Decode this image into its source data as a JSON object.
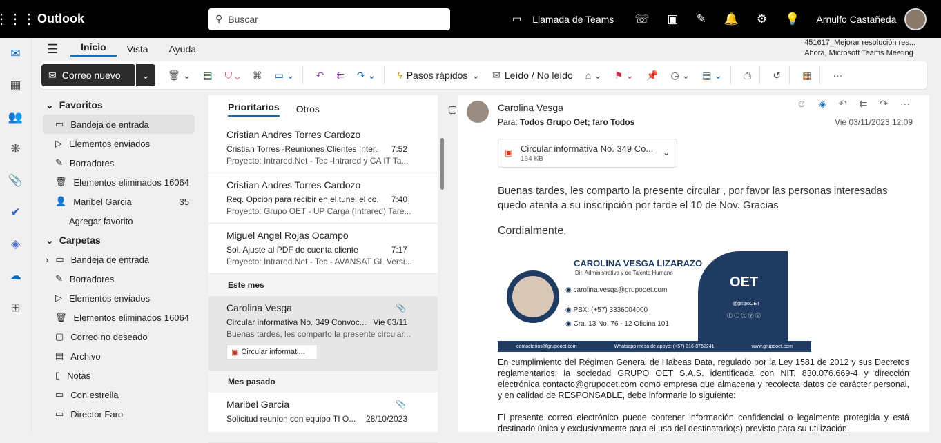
{
  "topbar": {
    "app_name": "Outlook",
    "search_placeholder": "Buscar",
    "teams_call": "Llamada de Teams",
    "user_name": "Arnulfo Castañeda"
  },
  "menubar": {
    "tabs": [
      "Inicio",
      "Vista",
      "Ayuda"
    ],
    "meeting_title": "451617_Mejorar resolución res...",
    "meeting_time": "Ahora, Microsoft Teams Meeting"
  },
  "ribbon": {
    "new_mail": "Correo nuevo",
    "quick_steps": "Pasos rápidos",
    "read_unread": "Leído / No leído"
  },
  "folders": {
    "favorites_header": "Favoritos",
    "favorites": [
      {
        "label": "Bandeja de entrada",
        "count": ""
      },
      {
        "label": "Elementos enviados",
        "count": ""
      },
      {
        "label": "Borradores",
        "count": ""
      },
      {
        "label": "Elementos eliminados",
        "count": "16064"
      },
      {
        "label": "Maribel Garcia",
        "count": "35"
      },
      {
        "label": "Agregar favorito",
        "count": ""
      }
    ],
    "folders_header": "Carpetas",
    "folders": [
      {
        "label": "Bandeja de entrada",
        "count": ""
      },
      {
        "label": "Borradores",
        "count": ""
      },
      {
        "label": "Elementos enviados",
        "count": ""
      },
      {
        "label": "Elementos eliminados",
        "count": "16064"
      },
      {
        "label": "Correo no deseado",
        "count": ""
      },
      {
        "label": "Archivo",
        "count": ""
      },
      {
        "label": "Notas",
        "count": ""
      },
      {
        "label": "Con estrella",
        "count": ""
      },
      {
        "label": "Director Faro",
        "count": ""
      }
    ]
  },
  "list": {
    "tab_focused": "Prioritarios",
    "tab_other": "Otros",
    "items": [
      {
        "from": "Cristian Andres Torres Cardozo",
        "subject": "Cristian Torres -Reuniones Clientes Inter...",
        "time": "7:52",
        "preview": "Proyecto: Intrared.Net - Tec -Intrared y CA IT Ta..."
      },
      {
        "from": "Cristian Andres Torres Cardozo",
        "subject": "Req. Opcion para recibir en el tunel el co...",
        "time": "7:40",
        "preview": "Proyecto: Grupo OET - UP Carga (Intrared) Tare..."
      },
      {
        "from": "Miguel Angel Rojas Ocampo",
        "subject": "Sol. Ajuste al PDF de cuenta cliente",
        "time": "7:17",
        "preview": "Proyecto: Intrared.Net - Tec - AVANSAT GL Versi..."
      }
    ],
    "group_this_month": "Este mes",
    "selected": {
      "from": "Carolina Vesga",
      "subject": "Circular informativa No. 349 Convoc...",
      "time": "Vie 03/11",
      "preview": "Buenas tardes, les comparto la presente circular...",
      "attachment": "Circular informati..."
    },
    "group_last_month": "Mes pasado",
    "last": {
      "from": "Maribel Garcia",
      "subject": "Solicitud reunion con equipo TI O...",
      "time": "28/10/2023"
    }
  },
  "reader": {
    "from": "Carolina Vesga",
    "to_label": "Para:",
    "to": "Todos Grupo Oet;   faro Todos",
    "date": "Vie 03/11/2023 12:09",
    "attachment_name": "Circular informativa No. 349 Co...",
    "attachment_size": "164 KB",
    "body_line": "Buenas tardes, les comparto la presente circular , por favor las personas interesadas quedo atenta a su inscripción por tarde el 10 de Nov. Gracias",
    "closing": "Cordialmente,",
    "signature": {
      "name": "CAROLINA VESGA LIZARAZO",
      "role": "Dir. Administrativa y de Talento Humano",
      "email": "carolina.vesga@grupooet.com",
      "phone": "PBX: (+57) 3336004000",
      "address": "Cra. 13 No. 76 - 12 Oficina 101",
      "brand": "OET",
      "handle": "@grupoOET",
      "footer_email": "contactenos@grupooet.com",
      "footer_phone": "Whatsapp mesa de apoyo: (+57) 316-8762241",
      "footer_web": "www.grupooet.com"
    },
    "legal_1": "En cumplimiento del Régimen General de Habeas Data, regulado por la Ley 1581 de 2012 y sus Decretos reglamentarios; la sociedad GRUPO OET S.A.S. identificada con NIT. 830.076.669-4 y dirección electrónica contacto@grupooet.com como empresa que almacena y recolecta datos de carácter personal, y en calidad de RESPONSABLE, debe informarle lo siguiente:",
    "legal_2": "El presente correo electrónico puede contener información confidencial o legalmente protegida y está destinado única y exclusivamente para el uso del destinatario(s) previsto para su utilización"
  }
}
